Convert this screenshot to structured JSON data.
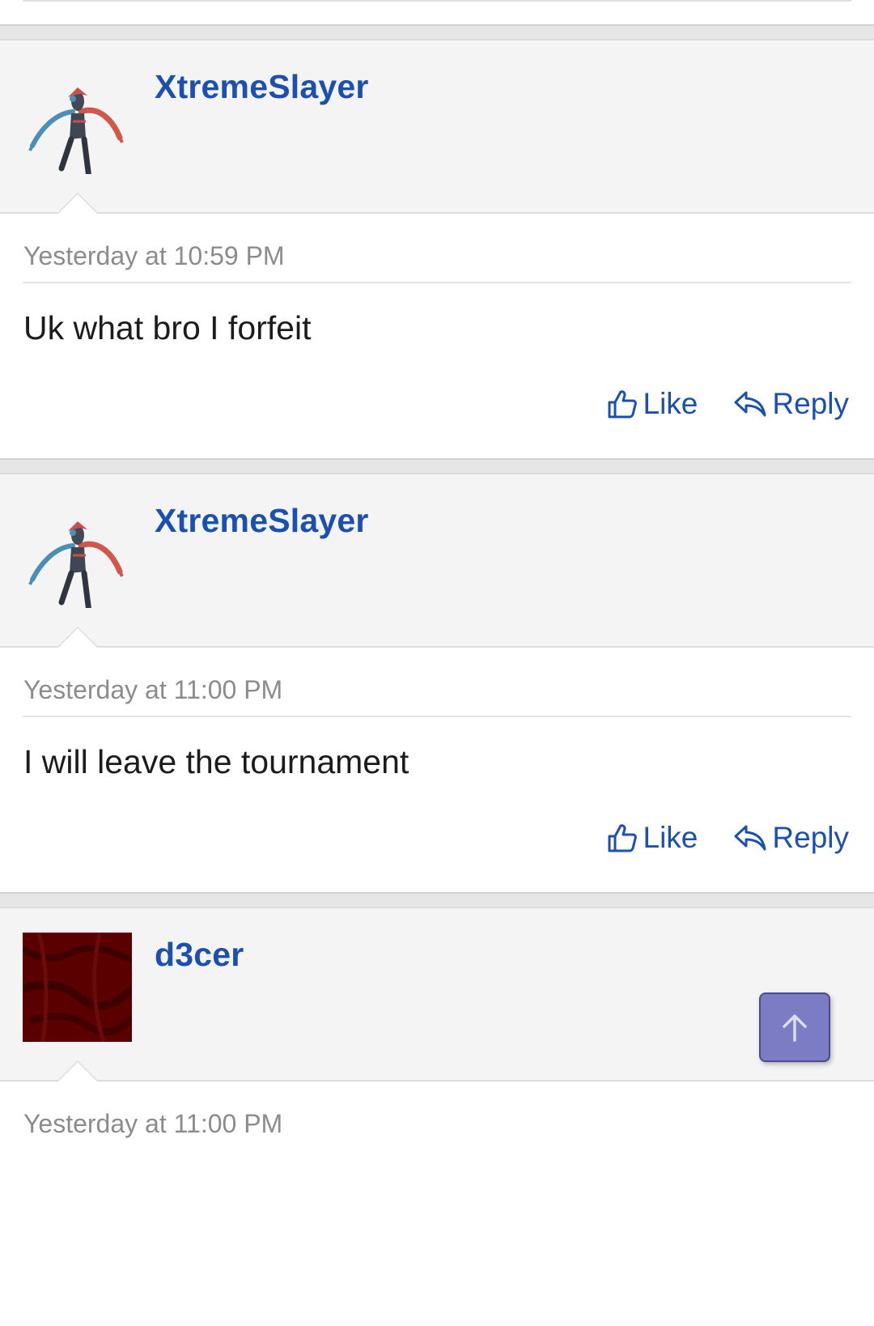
{
  "posts": [
    {
      "username": "XtremeSlayer",
      "avatar": "deoxys-sprite",
      "timestamp": "Yesterday at 10:59 PM",
      "message": "Uk what bro I forfeit",
      "like_label": "Like",
      "reply_label": "Reply"
    },
    {
      "username": "XtremeSlayer",
      "avatar": "deoxys-sprite",
      "timestamp": "Yesterday at 11:00 PM",
      "message": "I will leave the tournament",
      "like_label": "Like",
      "reply_label": "Reply"
    },
    {
      "username": "d3cer",
      "avatar": "dark-red-texture",
      "timestamp": "Yesterday at 11:00 PM"
    }
  ],
  "scroll_top": {
    "icon": "arrow-up-icon"
  },
  "colors": {
    "link": "#1b4fb0",
    "header_bg": "#f4f4f4",
    "scroll_button": "#7b7cc4",
    "avatar_dark_red": "#5a0000"
  }
}
